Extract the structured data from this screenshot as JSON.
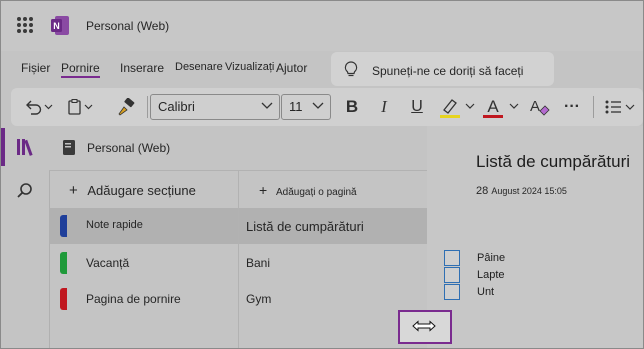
{
  "app": {
    "title": "Personal (Web)",
    "accent": "#7a2b8f"
  },
  "menu": {
    "items": [
      "Fișier",
      "Pornire",
      "Inserare",
      "Desenare",
      "Vizualizați",
      "Ajutor"
    ],
    "active_index": 1
  },
  "search": {
    "text": "Spuneți-ne ce doriți să faceți"
  },
  "toolbar": {
    "font_name": "Calibri",
    "font_size": "11",
    "bold": "B",
    "italic": "I",
    "underline": "U",
    "font_color_glyph": "A",
    "more": "···",
    "highlight_color": "#e6d41f",
    "font_color": "#c0171f"
  },
  "notebook": {
    "name": "Personal (Web)",
    "add_section": "Adăugare secțiune",
    "add_page": "Adăugați o pagină",
    "sections": [
      {
        "label": "Note rapide",
        "color": "#1f3f9a"
      },
      {
        "label": "Vacanță",
        "color": "#1f9a3a"
      },
      {
        "label": "Pagina de pornire",
        "color": "#c0171f"
      }
    ],
    "pages": [
      "Listă de cumpărături",
      "Bani",
      "Gym"
    ]
  },
  "content": {
    "title": "Listă de cumpărături",
    "date_day": "28",
    "date_rest": "August 2024 15:05",
    "checklist": [
      "Pâine",
      "Lapte",
      "Unt"
    ]
  },
  "icons": {
    "rail_top": "library-icon",
    "rail_search": "search-icon",
    "resize_cursor": "resize-horizontal-icon"
  }
}
